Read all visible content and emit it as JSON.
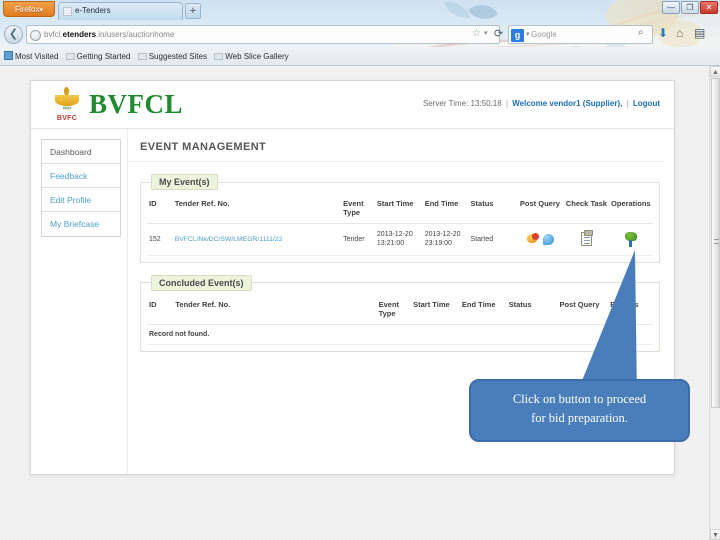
{
  "browser": {
    "app_button": "Firefox",
    "app_button_caret": "▾",
    "tab_title": "e-Tenders",
    "new_tab_label": "+",
    "window_minimize": "—",
    "window_restore": "❐",
    "window_close": "✕",
    "back_arrow": "❮",
    "url_prefix": "bvfcl.",
    "url_domain": "etenders",
    "url_suffix": ".in/users/auctionhome",
    "star_icon": "☆",
    "star_caret": "▾",
    "reload_icon": "⟳",
    "search_engine_letter": "g",
    "search_engine_caret": "▾",
    "search_placeholder": "Google",
    "magnify_icon": "⌕",
    "download_icon": "⬇",
    "home_icon": "⌂",
    "page_icon": "▤",
    "page_icon_caret": "▾",
    "bookmarks": [
      {
        "label": "Most Visited",
        "icon": "visited-icon"
      },
      {
        "label": "Getting Started",
        "icon": "folder-icon"
      },
      {
        "label": "Suggested Sites",
        "icon": "folder-icon"
      },
      {
        "label": "Web Slice Gallery",
        "icon": "folder-icon"
      }
    ]
  },
  "site": {
    "logo_text": "BVFCL",
    "logo_emblem_hindi": "ब्रह्मपुत्र",
    "logo_emblem_abbr": "BVFC",
    "server_time_label": "Server Time:",
    "server_time_value": "13:50:18",
    "welcome_text": "Welcome vendor1 (Supplier),",
    "logout_label": "Logout",
    "separator": "|"
  },
  "sidebar": {
    "items": [
      {
        "label": "Dashboard",
        "active": true
      },
      {
        "label": "Feedback",
        "active": false
      },
      {
        "label": "Edit Profile",
        "active": false
      },
      {
        "label": "My Briefcase",
        "active": false
      }
    ]
  },
  "main": {
    "page_title": "EVENT MANAGEMENT",
    "my_events": {
      "legend": "My Event(s)",
      "columns": [
        "ID",
        "Tender Ref. No.",
        "Event Type",
        "Start Time",
        "End Time",
        "Status",
        "Post Query",
        "Check Task",
        "Operations"
      ],
      "rows": [
        {
          "id": "152",
          "tender_ref": "BVFCL/Nk/DC/SW/LMEGR/1111/22",
          "event_type": "Tender",
          "start_date": "2013-12-20",
          "start_clock": "13:21:00",
          "end_date": "2013-12-20",
          "end_clock": "23:19:00",
          "status": "Started",
          "post_query_icons": [
            "query-balloon-icon",
            "chat-bubble-icon"
          ],
          "check_task_icon": "clipboard-icon",
          "operations_icon": "bid-preparation-icon"
        }
      ]
    },
    "concluded_events": {
      "legend": "Concluded Event(s)",
      "columns": [
        "ID",
        "Tender Ref. No.",
        "Event Type",
        "Start Time",
        "End Time",
        "Status",
        "Post Query",
        "Reports"
      ],
      "empty_message": "Record not found."
    }
  },
  "annotation": {
    "callout_line1": "Click on button to proceed",
    "callout_line2": "for bid preparation.",
    "callout_color": "#4a7ebb",
    "arrow_color": "#4a7ebb"
  }
}
